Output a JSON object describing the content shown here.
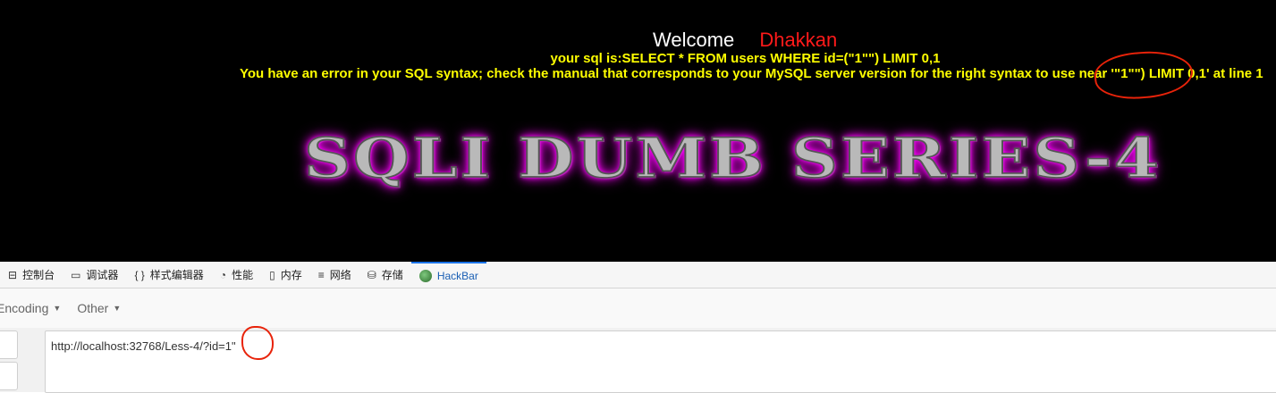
{
  "page": {
    "welcome": "Welcome",
    "username": "Dhakkan",
    "sql_line": "your sql is:SELECT * FROM users WHERE id=(\"1\"\") LIMIT 0,1",
    "error_line": "You have an error in your SQL syntax; check the manual that corresponds to your MySQL server version for the right syntax to use near '\"1\"\") LIMIT 0,1' at line 1",
    "banner": "SQLI DUMB SERIES-4"
  },
  "devtools": {
    "tabs": [
      {
        "label": "控制台",
        "icon": "console-icon"
      },
      {
        "label": "调试器",
        "icon": "debugger-icon"
      },
      {
        "label": "样式编辑器",
        "icon": "braces-icon"
      },
      {
        "label": "性能",
        "icon": "performance-icon"
      },
      {
        "label": "内存",
        "icon": "memory-icon"
      },
      {
        "label": "网络",
        "icon": "network-icon"
      },
      {
        "label": "存储",
        "icon": "storage-icon"
      },
      {
        "label": "HackBar",
        "icon": "hackbar-icon"
      }
    ],
    "active_tab": "HackBar"
  },
  "hackbar": {
    "menus": [
      "Encoding",
      "Other"
    ],
    "url": "http://localhost:32768/Less-4/?id=1\""
  },
  "colors": {
    "page_bg": "#000000",
    "sql_text": "#ffff00",
    "username": "#ff1a1a",
    "annotation": "#e8230a",
    "active_tab": "#1a73e8"
  }
}
